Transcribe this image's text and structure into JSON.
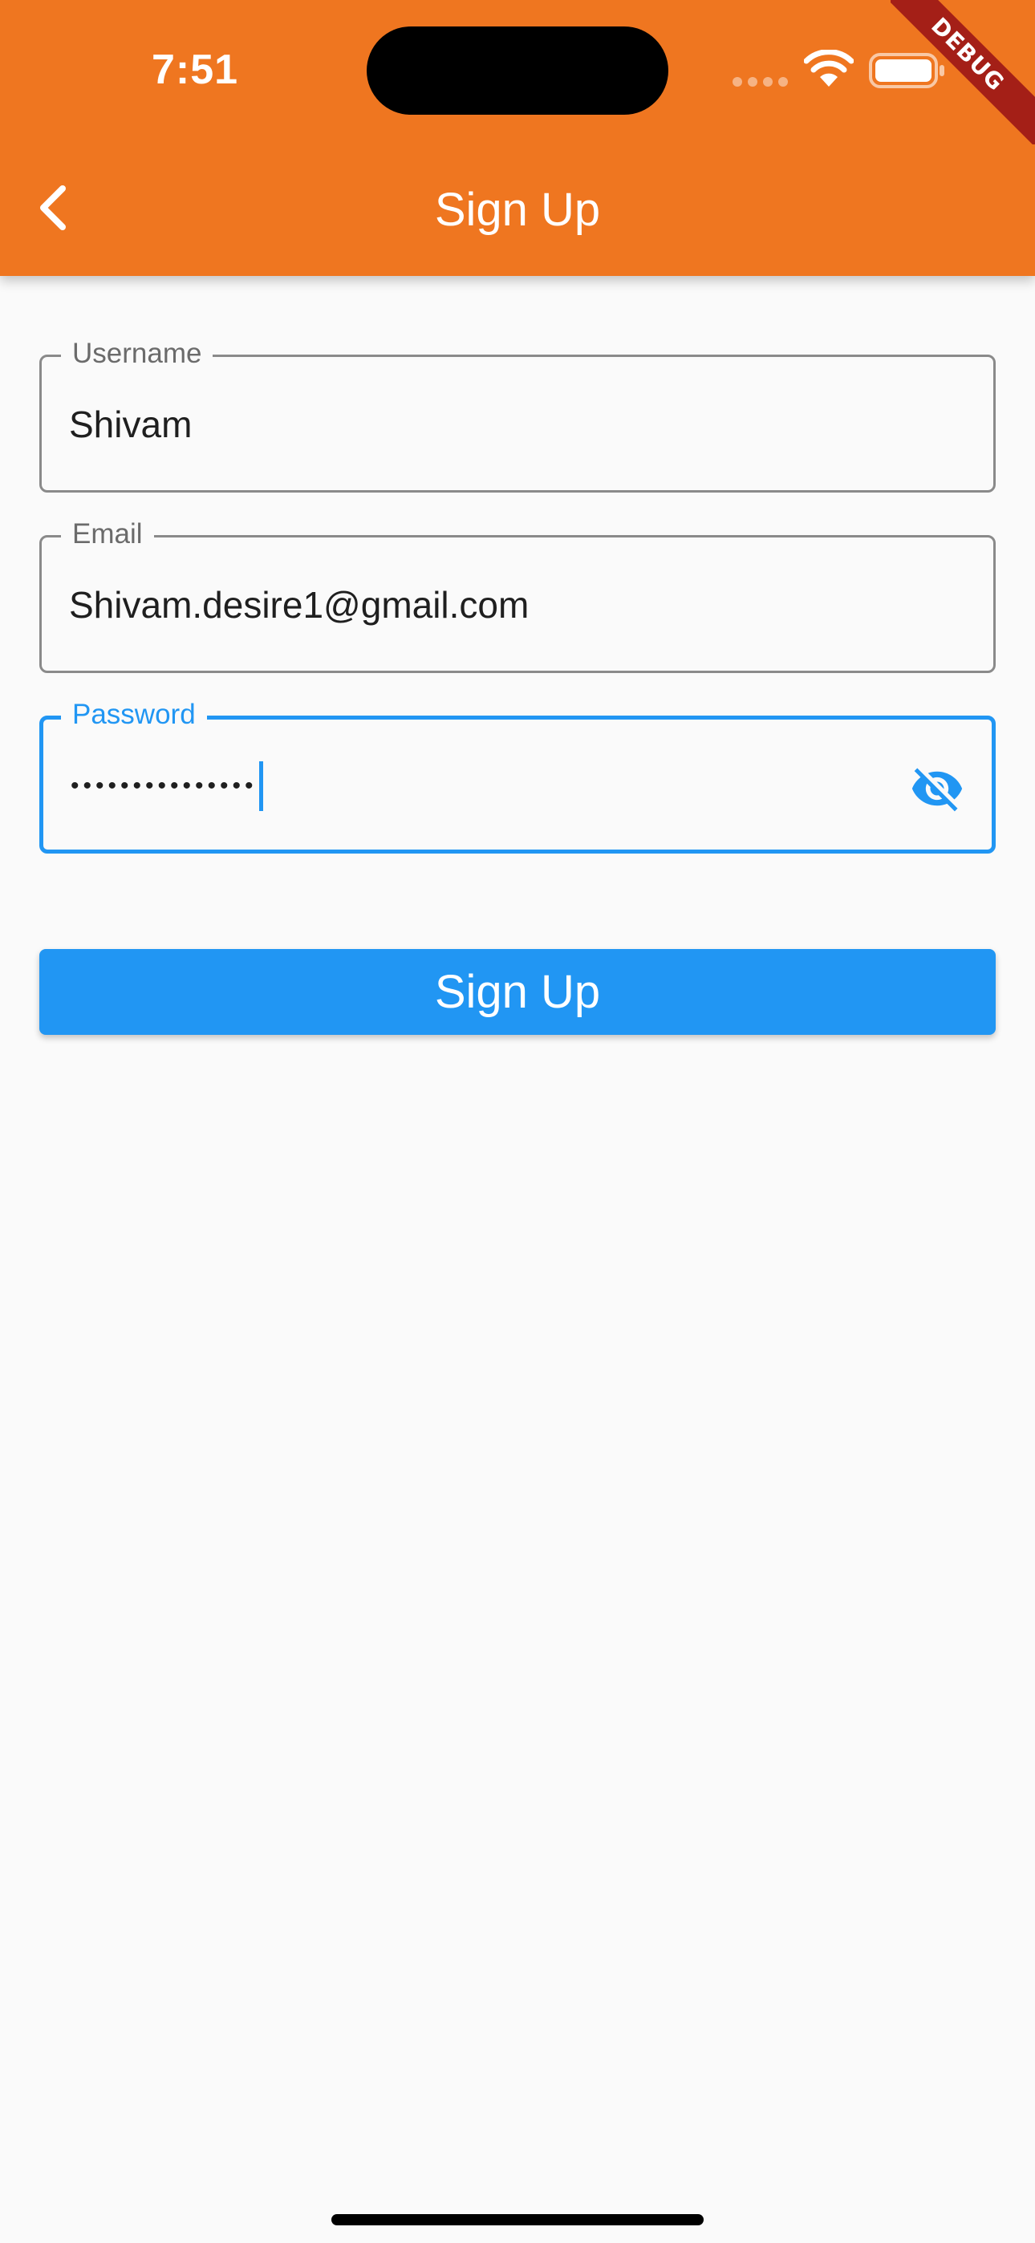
{
  "status_bar": {
    "time": "7:51",
    "signal_icon": "cellular-signal-icon",
    "wifi_icon": "wifi-icon",
    "battery_icon": "battery-icon"
  },
  "app_bar": {
    "title": "Sign Up",
    "back_icon": "chevron-left-icon",
    "background_color": "#ef7620"
  },
  "debug_banner": {
    "text": "DEBUG",
    "color": "#a41f17"
  },
  "form": {
    "username": {
      "label": "Username",
      "value": "Shivam"
    },
    "email": {
      "label": "Email",
      "value": "Shivam.desire1@gmail.com"
    },
    "password": {
      "label": "Password",
      "masked_value": "•••••••••••••••",
      "focused": true,
      "toggle_icon": "visibility-off-icon"
    },
    "accent_color": "#2196f3"
  },
  "submit_button": {
    "label": "Sign Up",
    "color": "#2196f3"
  }
}
